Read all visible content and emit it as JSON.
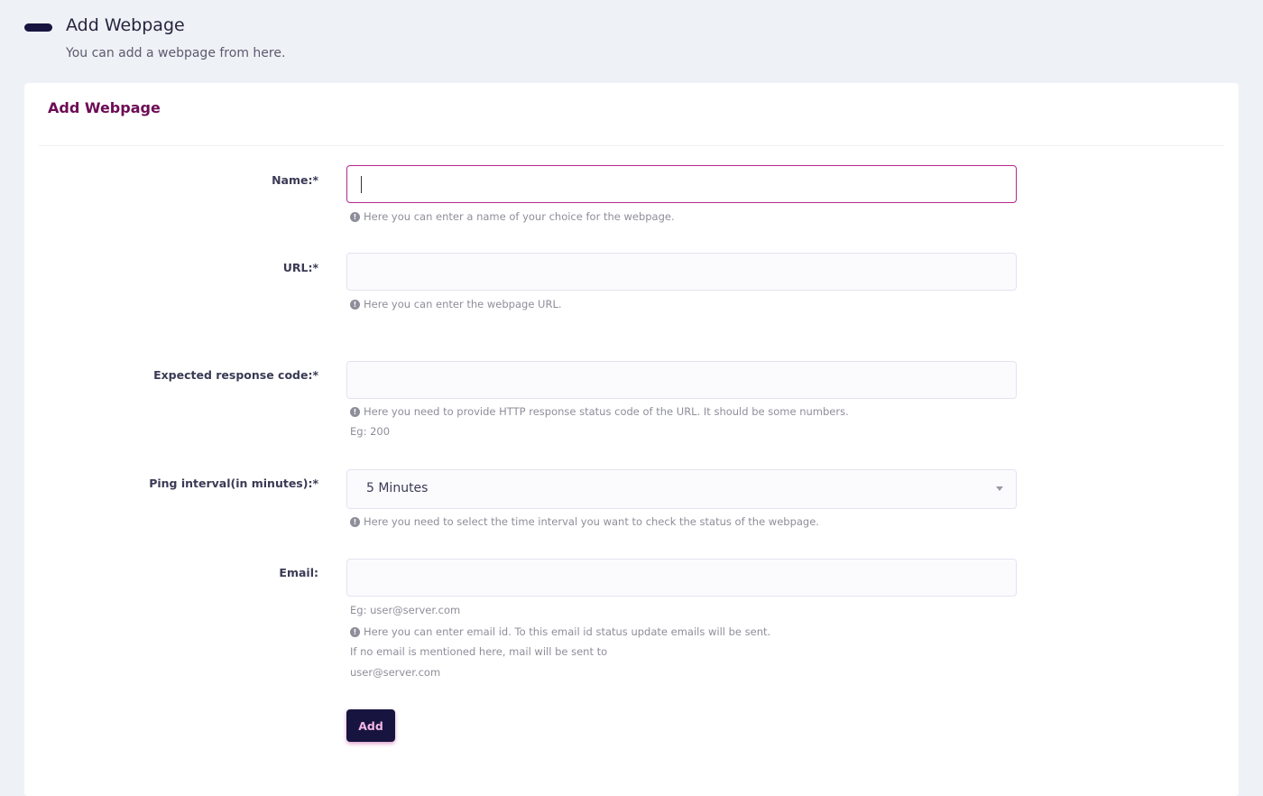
{
  "header": {
    "title": "Add Webpage",
    "subtitle": "You can add a webpage from here."
  },
  "card": {
    "title": "Add Webpage"
  },
  "form": {
    "name": {
      "label": "Name:*",
      "value": "",
      "help": "Here you can enter a name of your choice for the webpage."
    },
    "url": {
      "label": "URL:*",
      "value": "",
      "help": "Here you can enter the webpage URL."
    },
    "response_code": {
      "label": "Expected response code:*",
      "value": "",
      "help": "Here you need to provide HTTP response status code of the URL. It should be some numbers.",
      "example": "Eg: 200"
    },
    "ping_interval": {
      "label": "Ping interval(in minutes):*",
      "selected": "5 Minutes",
      "help": "Here you need to select the time interval you want to check the status of the webpage."
    },
    "email": {
      "label": "Email:",
      "value": "",
      "example": "Eg: user@server.com",
      "help": "Here you can enter email id. To this email id status update emails will be sent.",
      "note_line1": "If no email is mentioned here, mail will be sent to",
      "note_line2": "user@server.com"
    },
    "submit_label": "Add"
  },
  "colors": {
    "accent": "#b6288d",
    "title": "#6d0b55",
    "button_bg": "#17153f",
    "button_text": "#f4b6e6",
    "page_bg": "#eef1f5"
  },
  "icons": {
    "menu": "hamburger-icon",
    "info": "info-circle-icon",
    "dropdown": "chevron-down-icon"
  }
}
